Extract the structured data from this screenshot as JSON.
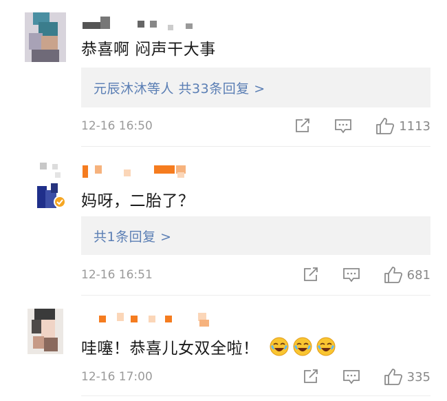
{
  "comments": [
    {
      "content": "恭喜啊 闷声干大事",
      "reply_summary": "元辰沐沐等人 共33条回复 >",
      "time": "12-16 16:50",
      "likes": "1113"
    },
    {
      "content": "妈呀，二胎了？",
      "reply_summary": "共1条回复 >",
      "time": "12-16 16:51",
      "likes": "681"
    },
    {
      "content": "哇噻！恭喜儿女双全啦！",
      "emojis": [
        "laugh-cry-emoji",
        "laugh-cry-emoji",
        "laugh-cry-emoji"
      ],
      "time": "12-16 17:00",
      "likes": "335"
    }
  ],
  "icons": {
    "share": "share-icon",
    "comment": "comment-icon",
    "like": "thumbs-up-icon"
  },
  "colors": {
    "reply_link": "#5a7eb4",
    "name_orange": "#f57c1f",
    "verified_badge": "#f5a623"
  }
}
